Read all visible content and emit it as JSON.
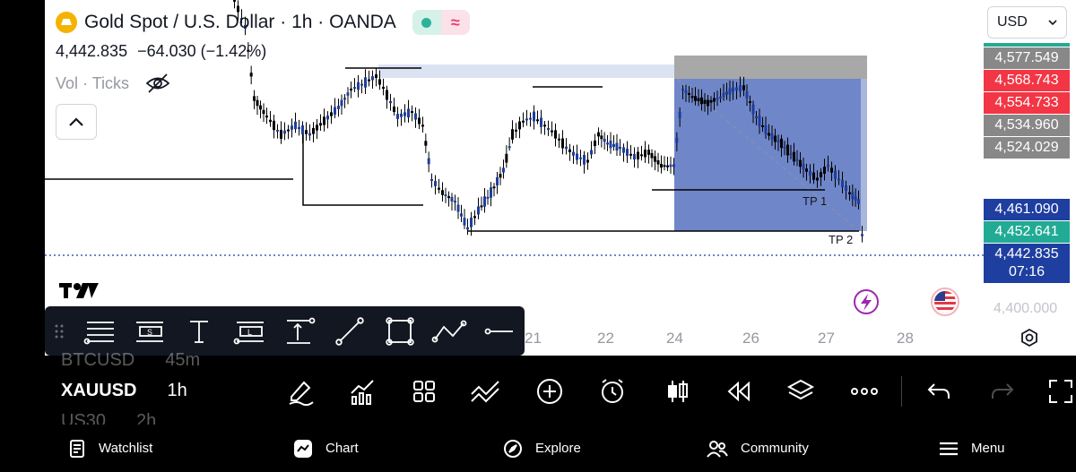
{
  "header": {
    "symbol_title": "Gold Spot / U.S. Dollar · 1h · OANDA",
    "last_price": "4,442.835",
    "change": "−64.030 (−1.42%)",
    "volume_label": "Vol · Ticks",
    "pill_wave": "≈"
  },
  "currency_select": {
    "value": "USD"
  },
  "price_tags": [
    {
      "text": "4,577.549",
      "color": "#888888"
    },
    {
      "text": "4,568.743",
      "color": "#f23645"
    },
    {
      "text": "4,554.733",
      "color": "#f23645"
    },
    {
      "text": "4,534.960",
      "color": "#888888"
    },
    {
      "text": "4,524.029",
      "color": "#888888"
    },
    {
      "text": "4,461.090",
      "color": "#1e3ea0"
    },
    {
      "text": "4,452.641",
      "color": "#22ab94"
    },
    {
      "text": "4,442.835",
      "color": "#1e3ea0"
    },
    {
      "text": "07:16",
      "color": "#1e3ea0"
    }
  ],
  "price_axis": {
    "visible_label": "4,400.000"
  },
  "time_axis": [
    "21",
    "22",
    "24",
    "26",
    "27",
    "28"
  ],
  "annotations": {
    "tp1": "TP 1",
    "tp2": "TP 2"
  },
  "drawing_toolbar": {
    "tools": [
      "horizontal-lines-tool",
      "signpost-tool",
      "text-tool",
      "label-line-tool",
      "vertical-range-tool",
      "trend-line-tool",
      "rectangle-tool",
      "path-tool",
      "horizontal-line-tool"
    ]
  },
  "watchlist_peek": [
    {
      "symbol": "BTCUSD",
      "tf": "45m"
    },
    {
      "symbol": "XAUUSD",
      "tf": "1h"
    },
    {
      "symbol": "US30",
      "tf": "2h"
    }
  ],
  "nav": {
    "watchlist": "Watchlist",
    "chart": "Chart",
    "explore": "Explore",
    "community": "Community",
    "menu": "Menu"
  },
  "colors": {
    "candle": "#1e3ea0",
    "short_position_fill": "#6f86c9",
    "stop_zone": "#a8a8a8",
    "range_highlight": "#dbe3f3",
    "last_price_line": "#1e3ea0",
    "event_icon": "#9c27b0"
  }
}
